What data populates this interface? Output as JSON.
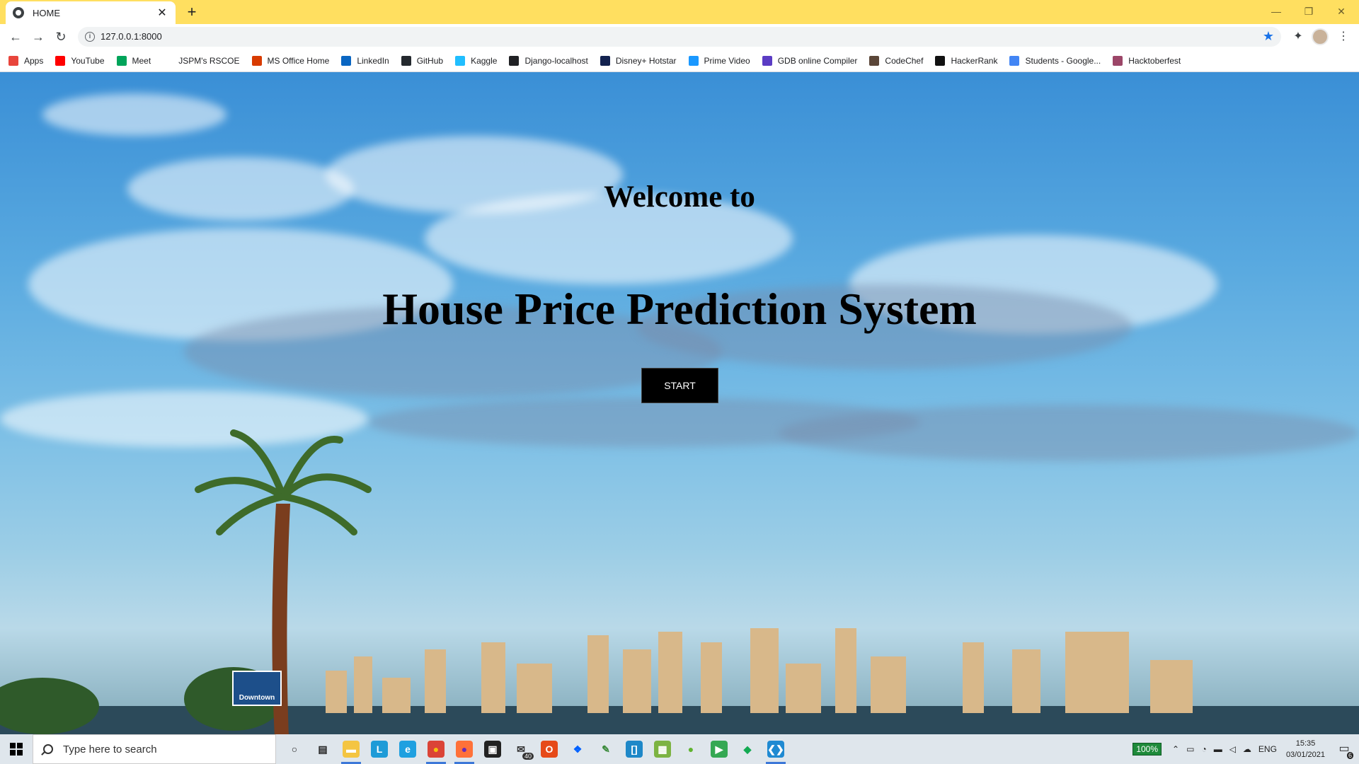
{
  "browser": {
    "tab": {
      "title": "HOME",
      "close": "✕"
    },
    "new_tab": "+",
    "window_controls": {
      "minimize": "—",
      "restore": "❐",
      "close": "✕"
    },
    "nav": {
      "back": "←",
      "forward": "→",
      "reload": "↻"
    },
    "address": "127.0.0.1:8000",
    "info_icon": "i",
    "star": "★",
    "menu": "⋮",
    "extensions": "✦"
  },
  "bookmarks": [
    {
      "label": "Apps",
      "color": "#e8453c"
    },
    {
      "label": "YouTube",
      "color": "#ff0000"
    },
    {
      "label": "Meet",
      "color": "#00a45a"
    },
    {
      "label": "JSPM's RSCOE",
      "color": "#ffffff"
    },
    {
      "label": "MS Office Home",
      "color": "#d83b01"
    },
    {
      "label": "LinkedIn",
      "color": "#0a66c2"
    },
    {
      "label": "GitHub",
      "color": "#24292e"
    },
    {
      "label": "Kaggle",
      "color": "#20beff"
    },
    {
      "label": "Django-localhost",
      "color": "#202124"
    },
    {
      "label": "Disney+ Hotstar",
      "color": "#13224f"
    },
    {
      "label": "Prime Video",
      "color": "#1a98ff"
    },
    {
      "label": "GDB online Compiler",
      "color": "#5b3cc4"
    },
    {
      "label": "CodeChef",
      "color": "#5b4638"
    },
    {
      "label": "HackerRank",
      "color": "#111111"
    },
    {
      "label": "Students - Google...",
      "color": "#4285f4"
    },
    {
      "label": "Hacktoberfest",
      "color": "#9c4668"
    }
  ],
  "page": {
    "welcome": "Welcome to",
    "headline": "House Price Prediction System",
    "start_button": "START",
    "sign_text": "Downtown"
  },
  "taskbar": {
    "search_placeholder": "Type here to search",
    "apps": [
      {
        "name": "cortana-icon",
        "glyph": "○",
        "color": "transparent",
        "fg": "#222"
      },
      {
        "name": "task-view-icon",
        "glyph": "▤",
        "color": "transparent",
        "fg": "#222"
      },
      {
        "name": "file-explorer-icon",
        "glyph": "▬",
        "color": "#f4c542",
        "fg": "#fff",
        "active": true
      },
      {
        "name": "l-app-icon",
        "glyph": "L",
        "color": "#1e9bd7",
        "fg": "#fff"
      },
      {
        "name": "edge-icon",
        "glyph": "e",
        "color": "#1fa0e0",
        "fg": "#fff"
      },
      {
        "name": "chrome-icon",
        "glyph": "●",
        "color": "#db4437",
        "fg": "#f4c20d",
        "active": true
      },
      {
        "name": "firefox-icon",
        "glyph": "●",
        "color": "#ff7139",
        "fg": "#6a2bb5",
        "active": true
      },
      {
        "name": "store-icon",
        "glyph": "▣",
        "color": "#222",
        "fg": "#fff"
      },
      {
        "name": "mail-icon",
        "glyph": "✉",
        "color": "transparent",
        "fg": "#333",
        "badge": "40"
      },
      {
        "name": "office-icon",
        "glyph": "O",
        "color": "#e64a19",
        "fg": "#fff"
      },
      {
        "name": "dropbox-icon",
        "glyph": "❖",
        "color": "transparent",
        "fg": "#0061ff"
      },
      {
        "name": "pen-icon",
        "glyph": "✎",
        "color": "transparent",
        "fg": "#3a8a3a"
      },
      {
        "name": "bracket-app-icon",
        "glyph": "[]",
        "color": "#1e88c8",
        "fg": "#fff"
      },
      {
        "name": "sheets-icon",
        "glyph": "▦",
        "color": "#7cb342",
        "fg": "#fff"
      },
      {
        "name": "leaf-app-icon",
        "glyph": "●",
        "color": "transparent",
        "fg": "#5fb32f"
      },
      {
        "name": "media-icon",
        "glyph": "▶",
        "color": "#35a853",
        "fg": "#fff"
      },
      {
        "name": "mongodb-icon",
        "glyph": "◆",
        "color": "transparent",
        "fg": "#13aa52"
      },
      {
        "name": "vscode-icon",
        "glyph": "❮❯",
        "color": "#1f8ad2",
        "fg": "#fff",
        "active": true
      }
    ],
    "tray": {
      "battery": "100%",
      "language": "ENG",
      "time": "15:35",
      "date": "03/01/2021",
      "notifications": "6"
    }
  }
}
